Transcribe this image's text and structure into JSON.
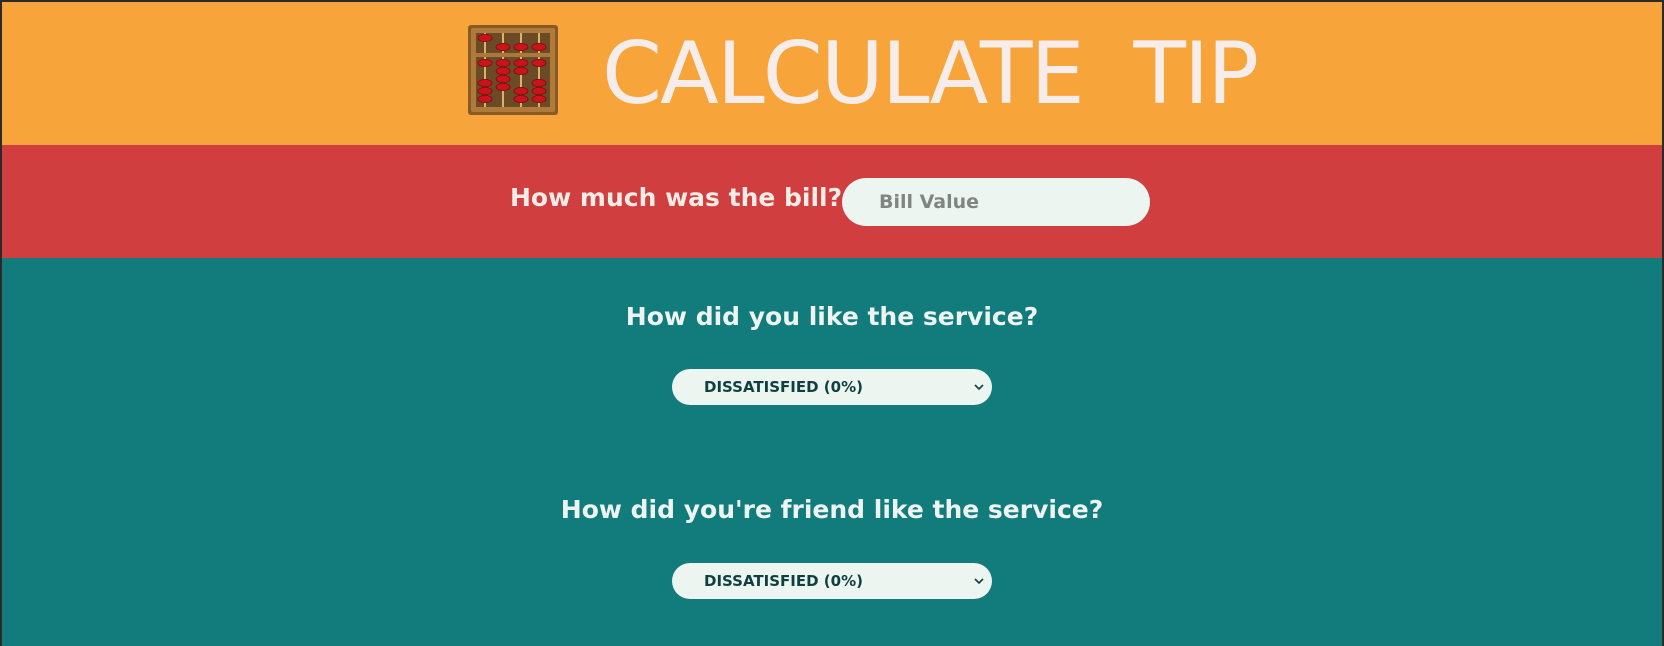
{
  "header": {
    "title": "CALCULATE  TIP",
    "logo_icon": "abacus-icon",
    "background": "#f7a43a"
  },
  "bill": {
    "label": "How much was the bill?",
    "placeholder": "Bill Value",
    "value": "",
    "background": "#d03e40"
  },
  "service": {
    "question": "How did you like the service?",
    "selected": "DISSATISFIED (0%)"
  },
  "friend_service": {
    "question": "How did you're friend like the service?",
    "selected": "DISSATISFIED (0%)"
  },
  "colors": {
    "teal": "#127c7d",
    "input_bg": "#ecf5f0",
    "bead_red": "#c8141a",
    "frame_wood": "#9a6a2f"
  }
}
